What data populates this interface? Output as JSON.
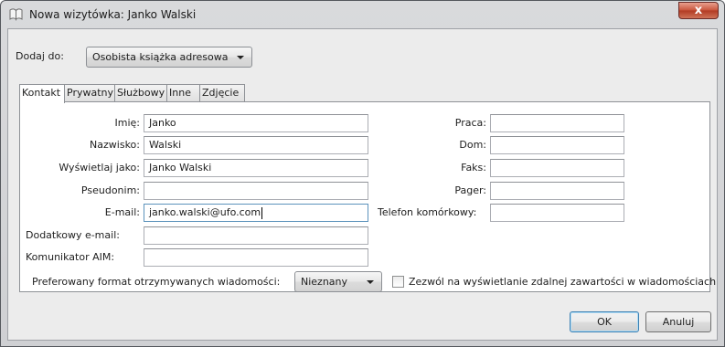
{
  "window": {
    "title": "Nowa wizytówka: Janko Walski",
    "close_glyph": "x"
  },
  "add_to": {
    "label": "Dodaj do:",
    "selected": "Osobista książka adresowa"
  },
  "tabs": [
    {
      "label": "Kontakt",
      "active": true
    },
    {
      "label": "Prywatny",
      "active": false
    },
    {
      "label": "Służbowy",
      "active": false
    },
    {
      "label": "Inne",
      "active": false
    },
    {
      "label": "Zdjęcie",
      "active": false
    }
  ],
  "contact_fields": [
    {
      "label": "Imię:",
      "value": "Janko"
    },
    {
      "label": "Nazwisko:",
      "value": "Walski"
    },
    {
      "label": "Wyświetlaj jako:",
      "value": "Janko Walski"
    },
    {
      "label": "Pseudonim:",
      "value": ""
    },
    {
      "label": "E-mail:",
      "value": "janko.walski@ufo.com"
    },
    {
      "label": "Dodatkowy e-mail:",
      "value": ""
    },
    {
      "label": "Komunikator AIM:",
      "value": ""
    }
  ],
  "phone_fields": [
    {
      "label": "Praca:",
      "value": ""
    },
    {
      "label": "Dom:",
      "value": ""
    },
    {
      "label": "Faks:",
      "value": ""
    },
    {
      "label": "Pager:",
      "value": ""
    },
    {
      "label": "Telefon komórkowy:",
      "value": ""
    }
  ],
  "preferred_format": {
    "label": "Preferowany format otrzymywanych wiadomości:",
    "selected": "Nieznany"
  },
  "remote_content": {
    "label": "Zezwól na wyświetlanie zdalnej zawartości w wiadomościach",
    "checked": false
  },
  "buttons": {
    "ok": "OK",
    "cancel": "Anuluj"
  }
}
